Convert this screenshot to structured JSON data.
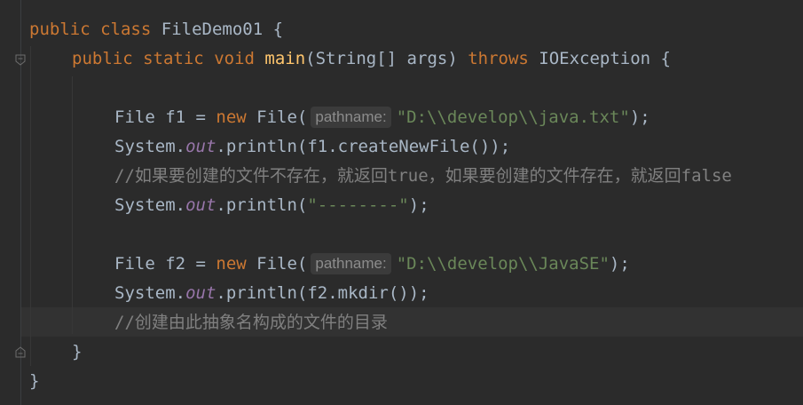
{
  "code": {
    "public1": "public",
    "class": "class",
    "class_name": "FileDemo01",
    "brace_open1": "{",
    "public2": "public",
    "static": "static",
    "void": "void",
    "main": "main",
    "main_params": "(String[] args) ",
    "throws": "throws",
    "exception": " IOException {",
    "l3_type": "File f1 = ",
    "new1": "new",
    "l3_ctor": " File(",
    "hint1": "pathname:",
    "l3_str": "\"D:\\\\develop\\\\java.txt\"",
    "l3_end": ");",
    "l4_a": "System.",
    "l4_out": "out",
    "l4_b": ".println(f1.createNewFile());",
    "l5_comment": "//如果要创建的文件不存在，就返回true，如果要创建的文件存在，就返回false",
    "l6_a": "System.",
    "l6_out": "out",
    "l6_b": ".println(",
    "l6_str": "\"--------\"",
    "l6_c": ");",
    "l8_type": "File f2 = ",
    "new2": "new",
    "l8_ctor": " File(",
    "hint2": "pathname:",
    "l8_str": "\"D:\\\\develop\\\\JavaSE\"",
    "l8_end": ");",
    "l9_a": "System.",
    "l9_out": "out",
    "l9_b": ".println(f2.mkdir());",
    "l10_comment": "//创建由此抽象名构成的文件的目录",
    "close_method": "}",
    "close_class": "}"
  },
  "colors": {
    "background": "#2b2b2b",
    "keyword": "#cc7832",
    "method": "#ffc66d",
    "string": "#6a8759",
    "field": "#9876aa",
    "comment": "#808080",
    "text": "#a9b7c6"
  }
}
